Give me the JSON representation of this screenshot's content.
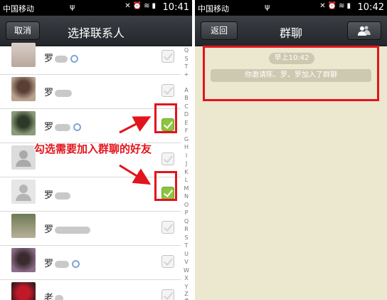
{
  "left": {
    "status": {
      "carrier": "中国移动",
      "signal": "▪▪▪",
      "time": "10:41"
    },
    "header": {
      "cancel": "取消",
      "title": "选择联系人"
    },
    "contacts": [
      {
        "name": "罗",
        "checked": false,
        "verified": true
      },
      {
        "name": "罗",
        "checked": false,
        "verified": false
      },
      {
        "name": "罗",
        "checked": true,
        "verified": true
      },
      {
        "name": "",
        "checked": false,
        "verified": false
      },
      {
        "name": "罗",
        "checked": true,
        "verified": false
      },
      {
        "name": "罗",
        "checked": false,
        "verified": false
      },
      {
        "name": "罗",
        "checked": false,
        "verified": true
      },
      {
        "name": "老",
        "checked": false,
        "verified": false
      }
    ],
    "index": [
      "Q",
      "S",
      "T",
      "+",
      "A",
      "B",
      "C",
      "D",
      "E",
      "F",
      "G",
      "H",
      "I",
      "J",
      "K",
      "L",
      "M",
      "N",
      "O",
      "P",
      "Q",
      "R",
      "S",
      "T",
      "U",
      "V",
      "W",
      "X",
      "Y",
      "Z",
      "#"
    ],
    "annotation": "勾选需要加入群聊的好友"
  },
  "right": {
    "status": {
      "carrier": "中国移动",
      "signal": "▪▪▪",
      "time": "10:42"
    },
    "header": {
      "back": "返回",
      "title": "群聊"
    },
    "timestamp": "早上10:42",
    "system_message": "你邀请陈、罗、罗加入了群聊"
  },
  "colors": {
    "accent_red": "#e1151b",
    "check_green": "#8bc53f",
    "chat_bg": "#ece7cf"
  }
}
